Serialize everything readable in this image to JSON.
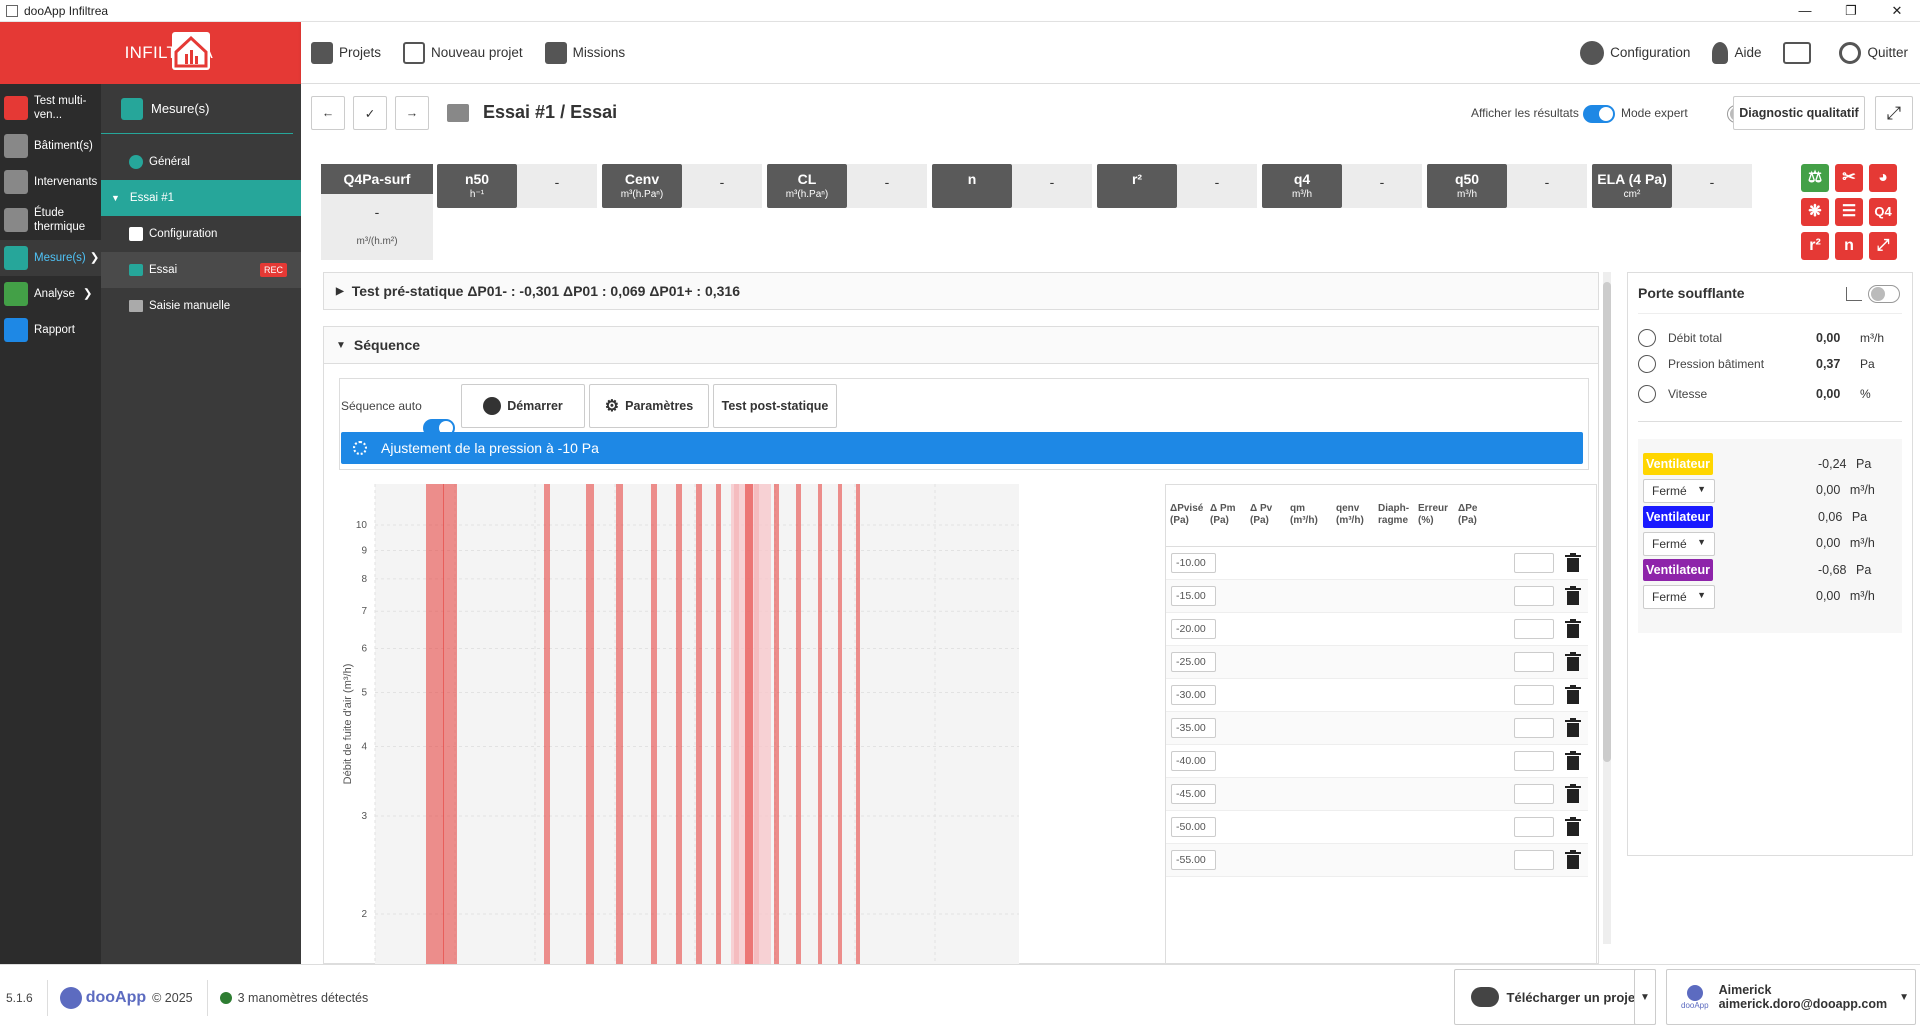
{
  "window": {
    "title": "dooApp Infiltrea"
  },
  "brand": {
    "name": "INFILTREA"
  },
  "topnav": {
    "projets": "Projets",
    "nouveau_projet": "Nouveau projet",
    "missions": "Missions",
    "configuration": "Configuration",
    "aide": "Aide",
    "quitter": "Quitter"
  },
  "leftside": [
    {
      "label": "Test multi-ven...",
      "color": "#e53935"
    },
    {
      "label": "Bâtiment(s)",
      "color": "#888"
    },
    {
      "label": "Intervenants",
      "color": "#888"
    },
    {
      "label": "Étude thermique",
      "color": "#888"
    },
    {
      "label": "Mesure(s)",
      "color": "#26a69a"
    },
    {
      "label": "Analyse",
      "color": "#43a047"
    },
    {
      "label": "Rapport",
      "color": "#1e88e5"
    }
  ],
  "tree": {
    "header": "Mesure(s)",
    "general": "Général",
    "essai1": "Essai #1",
    "configuration": "Configuration",
    "essai": "Essai",
    "rec": "REC",
    "saisie": "Saisie manuelle"
  },
  "toolbar": {
    "title": "Essai #1 / Essai",
    "afficher": "Afficher les résultats",
    "mode_expert": "Mode expert",
    "diagnostic": "Diagnostic qualitatif"
  },
  "metrics": [
    {
      "name": "Q4Pa-surf",
      "unit": "",
      "value": "-",
      "unit2": "m³/(h.m²)"
    },
    {
      "name": "n50",
      "unit": "h⁻¹",
      "value": "-"
    },
    {
      "name": "Cenv",
      "unit": "m³(h.Paⁿ)",
      "value": "-"
    },
    {
      "name": "CL",
      "unit": "m³(h.Paⁿ)",
      "value": "-"
    },
    {
      "name": "n",
      "unit": "",
      "value": "-"
    },
    {
      "name": "r²",
      "unit": "",
      "value": "-"
    },
    {
      "name": "q4",
      "unit": "m³/h",
      "value": "-"
    },
    {
      "name": "q50",
      "unit": "m³/h",
      "value": "-"
    },
    {
      "name": "ELA (4 Pa)",
      "unit": "cm²",
      "value": "-"
    }
  ],
  "redicons": {
    "r2": "r²",
    "n": "n",
    "q4": "Q4"
  },
  "prestat": {
    "label": "Test pré-statique ΔP01- : -0,301   ΔP01 : 0,069   ΔP01+ : 0,316"
  },
  "sequence": {
    "label": "Séquence",
    "auto": "Séquence auto",
    "demarrer": "Démarrer",
    "parametres": "Paramètres",
    "post": "Test post-statique",
    "progress": "Ajustement de la pression à -10 Pa"
  },
  "chart": {
    "ylabel": "Débit de fuite d'air (m³/h)",
    "yticks": [
      "10",
      "9",
      "8",
      "7",
      "6",
      "5",
      "4",
      "3",
      "2"
    ]
  },
  "table": {
    "headers": [
      [
        "ΔPvisé",
        "(Pa)"
      ],
      [
        "Δ Pm",
        "(Pa)"
      ],
      [
        "Δ Pv",
        "(Pa)"
      ],
      [
        "qm",
        "(m³/h)"
      ],
      [
        "qenv",
        "(m³/h)"
      ],
      [
        "Diaph-",
        "ragme"
      ],
      [
        "Erreur",
        "(%)"
      ],
      [
        "ΔPe",
        "(Pa)"
      ]
    ],
    "rows": [
      "-10.00",
      "-15.00",
      "-20.00",
      "-25.00",
      "-30.00",
      "-35.00",
      "-40.00",
      "-45.00",
      "-50.00",
      "-55.00"
    ]
  },
  "porte": {
    "title": "Porte soufflante",
    "debit_label": "Débit total",
    "debit_val": "0,00",
    "debit_unit": "m³/h",
    "pression_label": "Pression bâtiment",
    "pression_val": "0,37",
    "pression_unit": "Pa",
    "vitesse_label": "Vitesse",
    "vitesse_val": "0,00",
    "vitesse_unit": "%"
  },
  "fans": [
    {
      "label": "Ventilateur",
      "bg": "#ffd600",
      "fg": "#fff",
      "pa": "-0,24",
      "pa_unit": "Pa",
      "state": "Fermé",
      "flow": "0,00",
      "flow_unit": "m³/h"
    },
    {
      "label": "Ventilateur",
      "bg": "#1a1aff",
      "fg": "#fff",
      "pa": "0,06",
      "pa_unit": "Pa",
      "state": "Fermé",
      "flow": "0,00",
      "flow_unit": "m³/h"
    },
    {
      "label": "Ventilateur",
      "bg": "#8e24aa",
      "fg": "#fff",
      "pa": "-0,68",
      "pa_unit": "Pa",
      "state": "Fermé",
      "flow": "0,00",
      "flow_unit": "m³/h"
    }
  ],
  "status": {
    "version": "5.1.6",
    "brand": "dooApp",
    "copyright": "© 2025",
    "mano": "3 manomètres détectés",
    "telecharger": "Télécharger un projet",
    "user_name": "Aimerick",
    "user_email": "aimerick.doro@dooapp.com",
    "doo": "dooApp"
  }
}
